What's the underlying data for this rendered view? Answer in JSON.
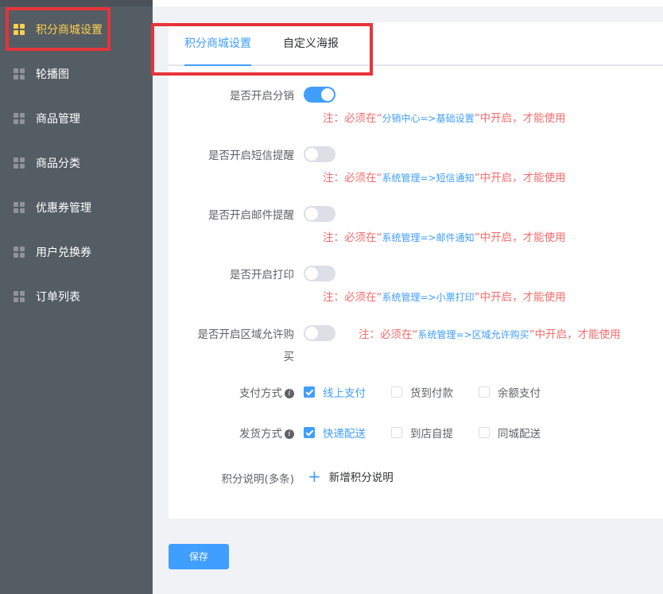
{
  "sidebar": {
    "items": [
      {
        "label": "积分商城设置",
        "active": true
      },
      {
        "label": "轮播图"
      },
      {
        "label": "商品管理"
      },
      {
        "label": "商品分类"
      },
      {
        "label": "优惠券管理"
      },
      {
        "label": "用户兑换券"
      },
      {
        "label": "订单列表"
      }
    ]
  },
  "tabs": [
    {
      "label": "积分商城设置",
      "active": true
    },
    {
      "label": "自定义海报"
    }
  ],
  "form": {
    "distribution": {
      "label": "是否开启分销",
      "enabled": true,
      "note_prefix": "注：必须在“",
      "note_link": "分销中心=>基础设置",
      "note_suffix": "”中开启，才能使用"
    },
    "sms": {
      "label": "是否开启短信提醒",
      "enabled": false,
      "note_prefix": "注：必须在“",
      "note_link": "系统管理=>短信通知",
      "note_suffix": "”中开启，才能使用"
    },
    "email": {
      "label": "是否开启邮件提醒",
      "enabled": false,
      "note_prefix": "注：必须在“",
      "note_link": "系统管理=>邮件通知",
      "note_suffix": "”中开启，才能使用"
    },
    "print": {
      "label": "是否开启打印",
      "enabled": false,
      "note_prefix": "注：必须在“",
      "note_link": "系统管理=>小票打印",
      "note_suffix": "”中开启，才能使用"
    },
    "region": {
      "label_line1": "是否开启区域允许购",
      "label_line2": "买",
      "enabled": false,
      "note_prefix": "注：必须在“",
      "note_link": "系统管理=>区域允许购买",
      "note_suffix": "”中开启，才能使用"
    },
    "payment": {
      "label": "支付方式",
      "options": [
        {
          "label": "线上支付",
          "checked": true
        },
        {
          "label": "货到付款",
          "checked": false
        },
        {
          "label": "余额支付",
          "checked": false
        }
      ]
    },
    "delivery": {
      "label": "发货方式",
      "options": [
        {
          "label": "快递配送",
          "checked": true
        },
        {
          "label": "到店自提",
          "checked": false
        },
        {
          "label": "同城配送",
          "checked": false
        }
      ]
    },
    "points_desc": {
      "label": "积分说明(多条)",
      "add_label": "新增积分说明"
    }
  },
  "save_label": "保存",
  "colors": {
    "primary": "#409eff",
    "danger": "#f56c6c",
    "sidebar_bg": "#545c64",
    "sidebar_active": "#ffd04b",
    "highlight": "#e8333a"
  }
}
